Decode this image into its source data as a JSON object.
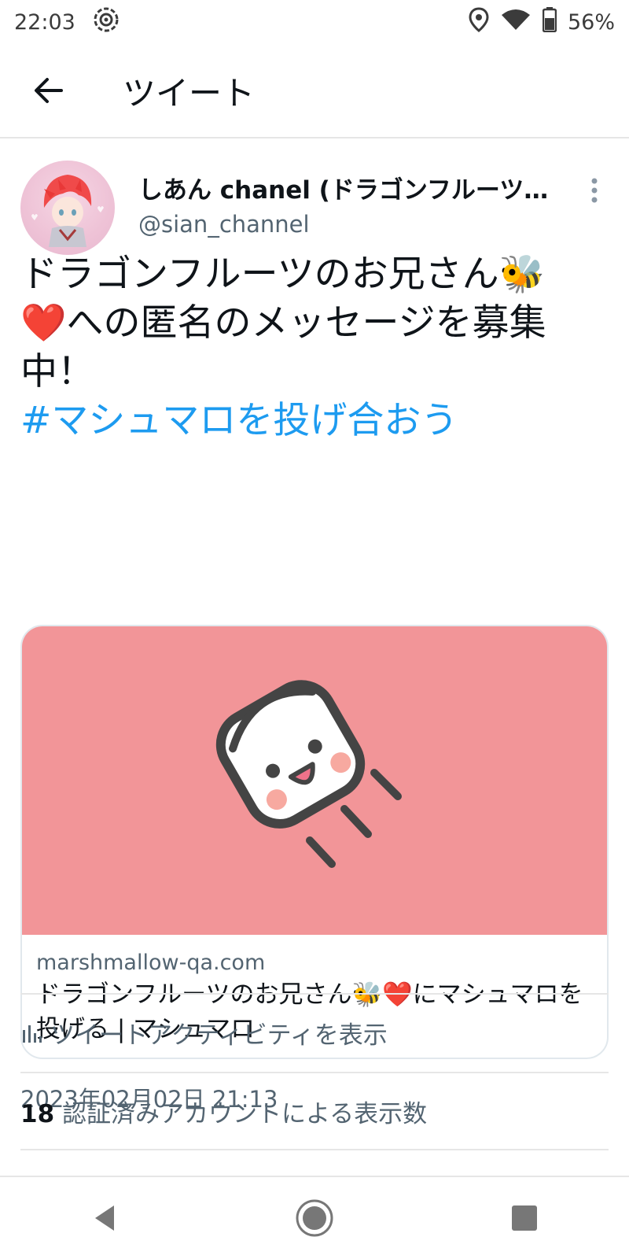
{
  "status_bar": {
    "time": "22:03",
    "battery": "56%",
    "icons": [
      "hotspot-icon",
      "location-icon",
      "wifi-icon",
      "battery-icon"
    ]
  },
  "app_bar": {
    "title": "ツイート"
  },
  "tweet": {
    "display_name": "しあん chanel (ドラゴンフルーツ…",
    "handle": "@sian_channel",
    "text_line1": "ドラゴンフルーツのお兄さん🐝",
    "text_line2": "❤️への匿名のメッセージを募集",
    "text_line3": "中！",
    "hashtag": "#マシュマロを投げ合おう",
    "timestamp": "2023年02月02日 21:13"
  },
  "card": {
    "domain": "marshmallow-qa.com",
    "title": "ドラゴンフルーツのお兄さん🐝❤️にマシュマロを投げる | マシュマロ"
  },
  "activity": {
    "label": "ツイートアクティビティを表示"
  },
  "views": {
    "count": "18",
    "label": " 認証済みアカウントによる表示数"
  },
  "colors": {
    "link": "#1d9bf0",
    "card_bg": "#f29598",
    "secondary_text": "#536471"
  }
}
